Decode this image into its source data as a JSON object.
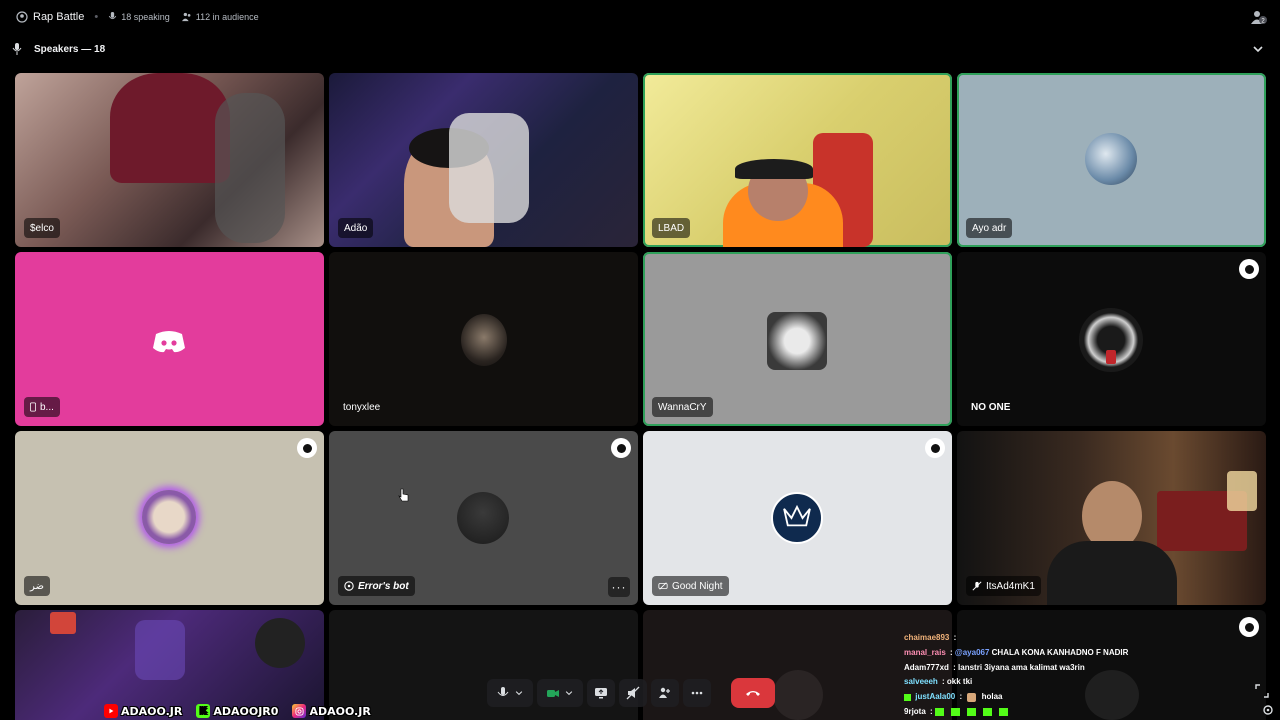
{
  "topbar": {
    "title": "Rap Battle",
    "speaking": "18 speaking",
    "audience": "112 in audience"
  },
  "section": {
    "label": "Speakers — 18"
  },
  "tiles": [
    {
      "name": "$elco",
      "color": "#8a6e68"
    },
    {
      "name": "Adão",
      "color": "#2a2740"
    },
    {
      "name": "LBAD",
      "color": "#d8cf7a"
    },
    {
      "name": "Ayo adr",
      "color": "#9db0ba"
    },
    {
      "name": "b...",
      "color": "#e33c9c"
    },
    {
      "name": "tonyxlee",
      "color": "#110f0d"
    },
    {
      "name": "WannaCrY",
      "color": "#9a9a9a"
    },
    {
      "name": "NO ONE",
      "color": "#0c0c0c"
    },
    {
      "name": "ضر",
      "color": "#c6c1b1"
    },
    {
      "name": "Error's bot",
      "color": "#4a4a4a"
    },
    {
      "name": "Good Night",
      "color": "#e3e5e8"
    },
    {
      "name": "ItsAd4mK1",
      "color": "#2b1f19"
    }
  ],
  "chat": [
    {
      "user": "chaimae893",
      "user_color": "#f0b27a",
      "text": ""
    },
    {
      "user": "manal_rais",
      "user_color": "#ff8fb4",
      "mention": "@aya067",
      "text": "CHALA KONA KANHADNO F NADIR"
    },
    {
      "user": "Adam777xd",
      "user_color": "#ffffff",
      "text": "lanstri 3iyana ama kalimat wa3rin"
    },
    {
      "user": "salveeeh",
      "user_color": "#7fe0ff",
      "text": "okk tki"
    },
    {
      "user": "justAala00",
      "user_color": "#7fe0ff",
      "text": "holaa"
    },
    {
      "user": "9rjota",
      "user_color": "#ffffff",
      "text": ""
    }
  ],
  "socials": {
    "youtube": "ADAOO.JR",
    "kick": "ADAOOJR0",
    "instagram": "ADAOO.JR"
  },
  "colors": {
    "hangup": "#da373c",
    "active_outline": "#2fa05a",
    "discord_pink": "#e33c9c"
  }
}
